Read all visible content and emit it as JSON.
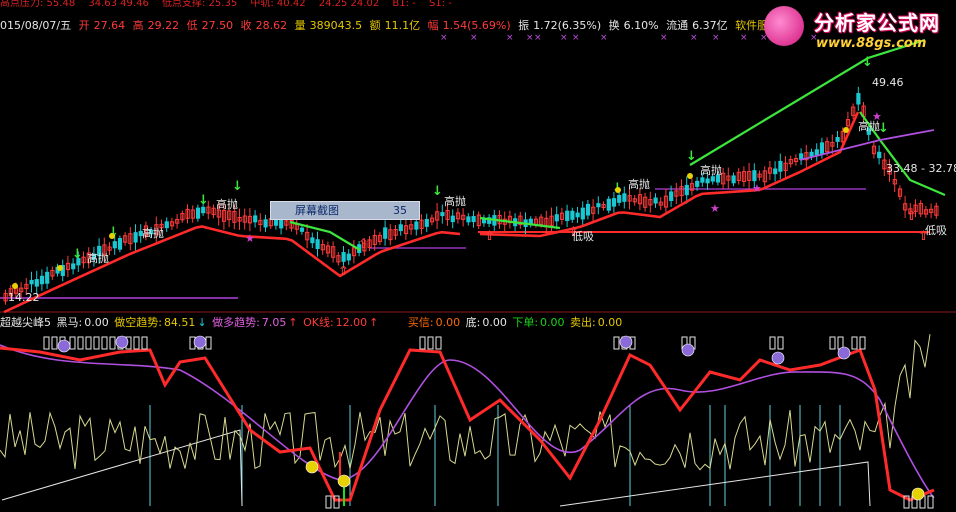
{
  "top_strip": {
    "items": [
      "高点压力: 55.48",
      "34.63  49.46",
      "低点支撑: 25.35",
      "中轨: 40.42",
      "24.25  24.02",
      "B1: -",
      "S1: -"
    ]
  },
  "info_bar": {
    "date": "015/08/07/五",
    "open_label": "开",
    "open": "27.64",
    "high_label": "高",
    "high": "29.22",
    "low_label": "低",
    "low": "27.50",
    "close_label": "收",
    "close": "28.62",
    "vol_label": "量",
    "vol": "389043.5",
    "amt_label": "额",
    "amt": "11.1亿",
    "chg_label": "幅",
    "chg": "1.54(5.69%)",
    "amp_label": "振",
    "amp": "1.72(6.35%)",
    "turn_label": "换",
    "turn": "6.10%",
    "float_label": "流通",
    "float": "6.37亿",
    "service": "软件服务"
  },
  "popup": {
    "label": "屏幕截图",
    "value": "35"
  },
  "price_labels": {
    "high_mark": "49.46",
    "mid_marks": "33.48 - 32.78",
    "low_left": "14.22",
    "sell": "高抛",
    "buy": "低吸"
  },
  "indicator_bar": {
    "name": "超越尖峰5",
    "heima_label": "黑马:",
    "heima": "0.00",
    "kd_label": "做空趋势:",
    "kd": "84.51",
    "dd_label": "做多趋势:",
    "dd": "7.05",
    "ok_label": "OK线:",
    "ok": "12.00",
    "buy_label": "买信:",
    "buy": "0.00",
    "di_label": "底:",
    "di": "0.00",
    "xd_label": "下单:",
    "xd": "0.00",
    "sell_label": "卖出:",
    "sell": "0.00"
  },
  "logo": {
    "title": "分析家公式网",
    "url": "www.88gs.com"
  },
  "colors": {
    "up": "#ff3b3b",
    "down": "#19c8d2",
    "ma_red": "#ff2a2a",
    "ma_green": "#3ce63c",
    "purple": "#b050e0"
  }
}
